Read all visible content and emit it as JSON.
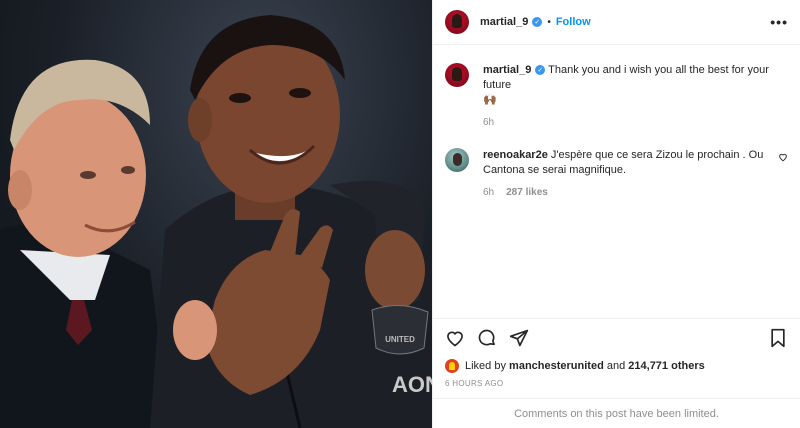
{
  "header": {
    "username": "martial_9",
    "separator": "•",
    "follow_label": "Follow",
    "more_label": "•••"
  },
  "caption": {
    "username": "martial_9",
    "text": "Thank you and i wish you all the best for your future",
    "emoji": "🙌🏾",
    "time": "6h"
  },
  "comments": [
    {
      "username": "reenoakar2e",
      "text": "J'espère que ce sera Zizou le prochain . Ou Cantona se serai magnifique.",
      "time": "6h",
      "likes": "287 likes"
    }
  ],
  "likes": {
    "prefix": "Liked by",
    "by_user": "manchesterunited",
    "and": "and",
    "count": "214,771 others"
  },
  "timestamp": "6 HOURS AGO",
  "comments_limited": "Comments on this post have been limited.",
  "photo": {
    "crest_text": "UNITED",
    "sponsor_text": "AON"
  },
  "colors": {
    "link_blue": "#0095f6",
    "verified_blue": "#3897f0",
    "muted": "#8e8e8e",
    "border": "#efefef"
  }
}
